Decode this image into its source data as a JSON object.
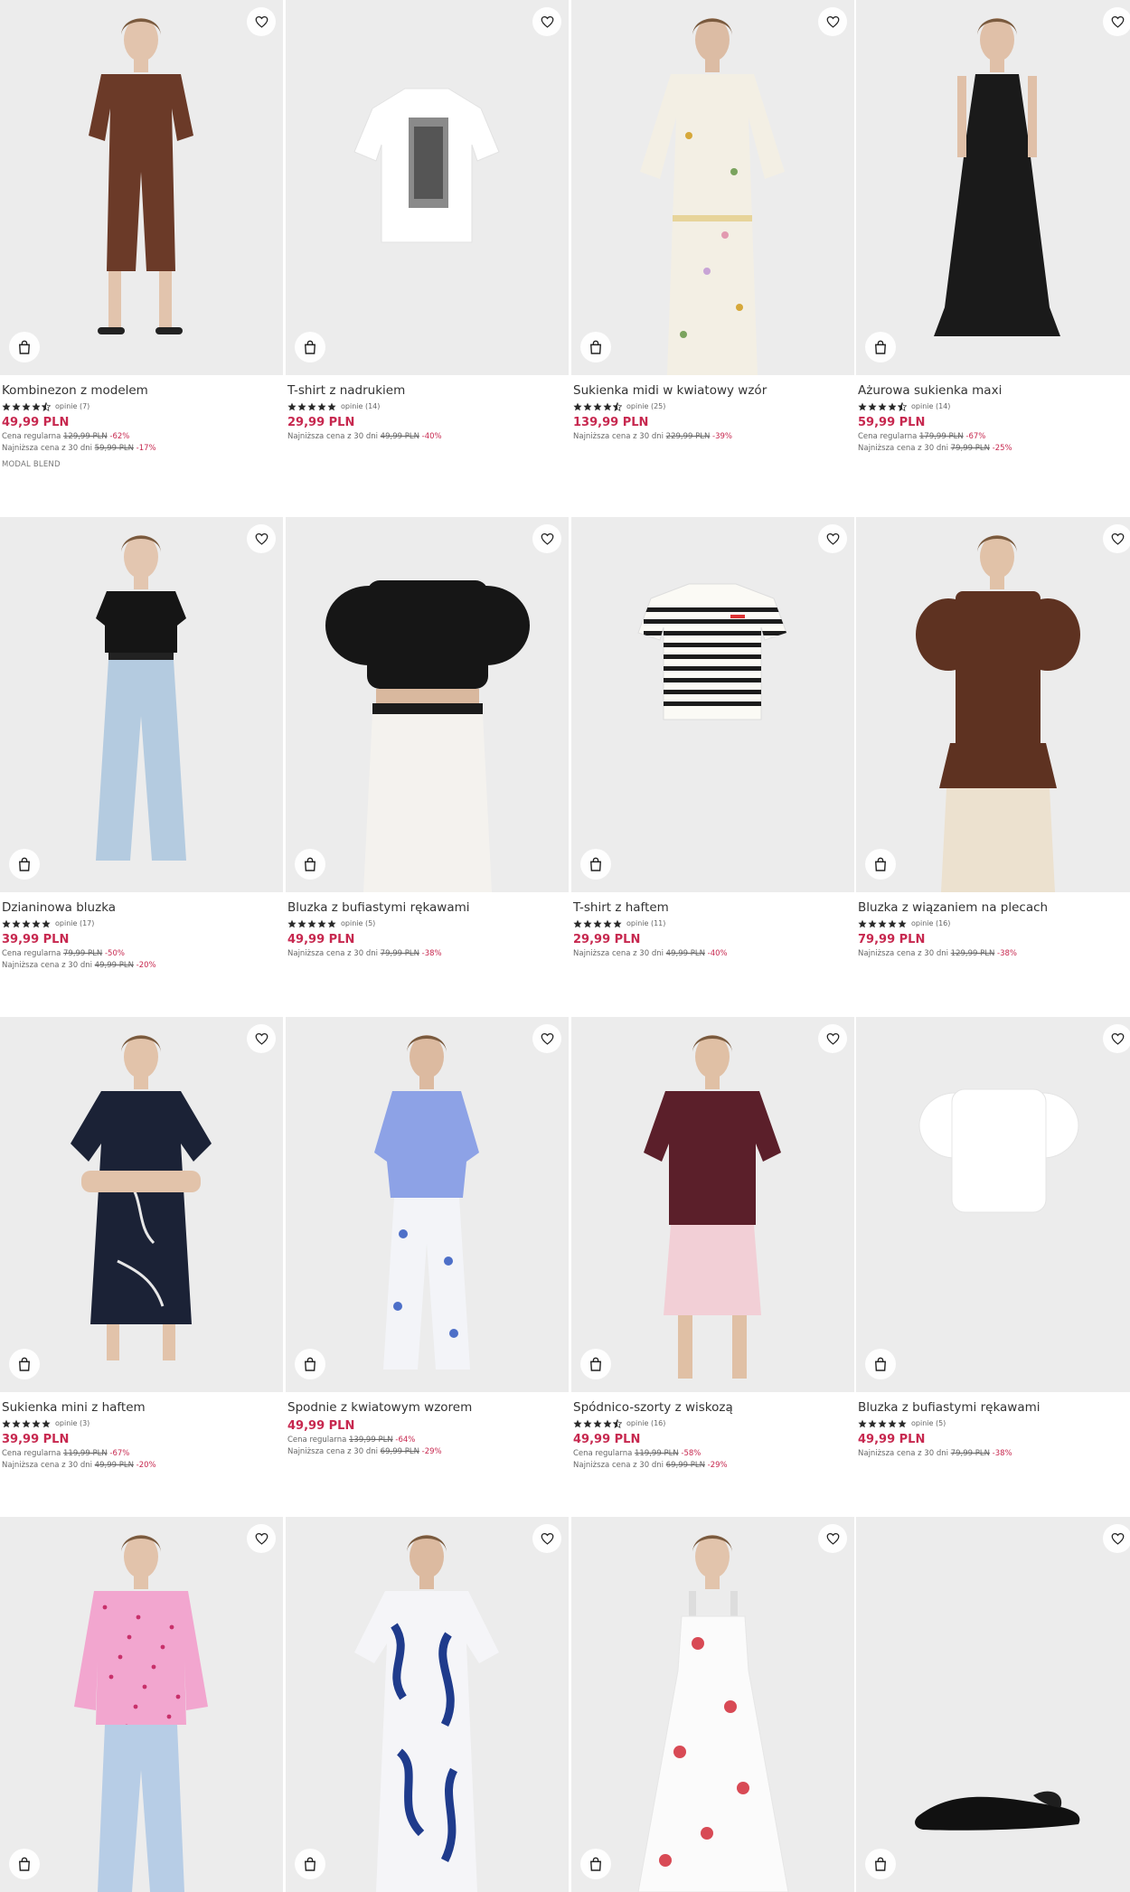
{
  "labels": {
    "reviews_prefix": "opinie",
    "regular": "Cena regularna",
    "lowest": "Najniższa cena z 30 dni"
  },
  "colors": {
    "accent": "#c7284f",
    "photo_bg": "#ececec"
  },
  "icons": {
    "wishlist": "heart-outline-icon",
    "cart": "shopping-bag-icon",
    "rating": "star-icon"
  },
  "products": [
    {
      "name": "Kombinezon z modelem",
      "rating": 4.5,
      "reviews": "opinie (7)",
      "price": "49,99 PLN",
      "regular": {
        "label": "Cena regularna",
        "old": "129,99 PLN",
        "disc": "-62%"
      },
      "lowest": {
        "label": "Najniższa cena z 30 dni",
        "old": "59,99 PLN",
        "disc": "-17%"
      },
      "tag": "MODAL BLEND",
      "garment": "jumpsuit",
      "garment_color": "#6b3a28",
      "skin": "#e2c4ad"
    },
    {
      "name": "T-shirt z nadrukiem",
      "rating": 5,
      "reviews": "opinie (14)",
      "price": "29,99 PLN",
      "lowest": {
        "label": "Najniższa cena z 30 dni",
        "old": "49,99 PLN",
        "disc": "-40%"
      },
      "garment": "tee-print",
      "garment_color": "#ffffff"
    },
    {
      "name": "Sukienka midi w kwiatowy wzór",
      "rating": 4.5,
      "reviews": "opinie (25)",
      "price": "139,99 PLN",
      "lowest": {
        "label": "Najniższa cena z 30 dni",
        "old": "229,99 PLN",
        "disc": "-39%"
      },
      "garment": "dress-floral",
      "garment_color": "#f3efe4",
      "skin": "#dcbca4"
    },
    {
      "name": "Ażurowa sukienka maxi",
      "rating": 4.5,
      "reviews": "opinie (14)",
      "price": "59,99 PLN",
      "regular": {
        "label": "Cena regularna",
        "old": "179,99 PLN",
        "disc": "-67%"
      },
      "lowest": {
        "label": "Najniższa cena z 30 dni",
        "old": "79,99 PLN",
        "disc": "-25%"
      },
      "garment": "maxi",
      "garment_color": "#1a1a1a",
      "skin": "#e0c0a8"
    },
    {
      "name": "Dzianinowa bluzka",
      "rating": 5,
      "reviews": "opinie (17)",
      "price": "39,99 PLN",
      "regular": {
        "label": "Cena regularna",
        "old": "79,99 PLN",
        "disc": "-50%"
      },
      "lowest": {
        "label": "Najniższa cena z 30 dni",
        "old": "49,99 PLN",
        "disc": "-20%"
      },
      "garment": "top-jeans",
      "garment_color": "#151515",
      "pants_color": "#b4cbe0",
      "skin": "#e3c6b0"
    },
    {
      "name": "Bluzka z bufiastymi rękawami",
      "rating": 5,
      "reviews": "opinie (5)",
      "price": "49,99 PLN",
      "lowest": {
        "label": "Najniższa cena z 30 dni",
        "old": "79,99 PLN",
        "disc": "-38%"
      },
      "garment": "puff-crop",
      "garment_color": "#161616",
      "pants_color": "#f4f2ee",
      "skin": "#d9b89e"
    },
    {
      "name": "T-shirt z haftem",
      "rating": 5,
      "reviews": "opinie (11)",
      "price": "29,99 PLN",
      "lowest": {
        "label": "Najniższa cena z 30 dni",
        "old": "49,99 PLN",
        "disc": "-40%"
      },
      "garment": "tee-stripe",
      "garment_color": "#fbfaf5"
    },
    {
      "name": "Bluzka z wiązaniem na plecach",
      "rating": 5,
      "reviews": "opinie (16)",
      "price": "79,99 PLN",
      "lowest": {
        "label": "Najniższa cena z 30 dni",
        "old": "129,99 PLN",
        "disc": "-38%"
      },
      "garment": "peplum",
      "garment_color": "#5e3221",
      "pants_color": "#ece1cf",
      "skin": "#e1c2a8"
    },
    {
      "name": "Sukienka mini z haftem",
      "rating": 5,
      "reviews": "opinie (3)",
      "price": "39,99 PLN",
      "regular": {
        "label": "Cena regularna",
        "old": "119,99 PLN",
        "disc": "-67%"
      },
      "lowest": {
        "label": "Najniższa cena z 30 dni",
        "old": "49,99 PLN",
        "disc": "-20%"
      },
      "garment": "mini",
      "garment_color": "#1b2236",
      "skin": "#e2c3aa"
    },
    {
      "name": "Spodnie z kwiatowym wzorem",
      "price": "49,99 PLN",
      "regular": {
        "label": "Cena regularna",
        "old": "139,99 PLN",
        "disc": "-64%"
      },
      "lowest": {
        "label": "Najniższa cena z 30 dni",
        "old": "69,99 PLN",
        "disc": "-29%"
      },
      "garment": "blue-top-pants",
      "garment_color": "#8da2e6",
      "pants_color": "#f3f4f8",
      "skin": "#dcbaa0"
    },
    {
      "name": "Spódnico-szorty z wiskozą",
      "rating": 4.5,
      "reviews": "opinie (16)",
      "price": "49,99 PLN",
      "regular": {
        "label": "Cena regularna",
        "old": "119,99 PLN",
        "disc": "-58%"
      },
      "lowest": {
        "label": "Najniższa cena z 30 dni",
        "old": "69,99 PLN",
        "disc": "-29%"
      },
      "garment": "skort",
      "garment_color": "#5b1f2a",
      "pants_color": "#f2cfd6",
      "skin": "#e0c0a5"
    },
    {
      "name": "Bluzka z bufiastymi rękawami",
      "rating": 5,
      "reviews": "opinie (5)",
      "price": "49,99 PLN",
      "lowest": {
        "label": "Najniższa cena z 30 dni",
        "old": "79,99 PLN",
        "disc": "-38%"
      },
      "garment": "puff-white",
      "garment_color": "#ffffff"
    },
    {
      "garment": "pink-shirt",
      "garment_color": "#f2a6cf",
      "pants_color": "#b7cde6",
      "skin": "#e2c3ab"
    },
    {
      "garment": "blue-dress",
      "garment_color": "#f5f5f8",
      "skin": "#dcbaa0"
    },
    {
      "garment": "rose-dress",
      "garment_color": "#fbfbfb",
      "skin": "#e2c4ac"
    },
    {
      "garment": "shoe",
      "garment_color": "#111111"
    }
  ]
}
